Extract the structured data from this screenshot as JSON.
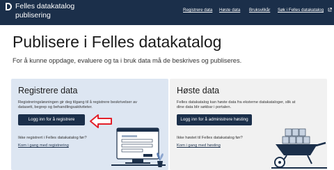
{
  "header": {
    "brand_line1": "Felles datakatalog",
    "brand_line2": "publisering",
    "nav": [
      "Registrere data",
      "Høste data",
      "Bruksvilkår",
      "Søk i Felles datakatalog"
    ]
  },
  "main": {
    "title": "Publisere i Felles datakatalog",
    "lead": "For å kunne oppdage, evaluere og ta i bruk data må de beskrives og publiseres."
  },
  "cards": {
    "register": {
      "title": "Registrere data",
      "desc_line1": "Registreringsløsningen gir deg tilgang til å registrere beskrivelser av",
      "desc_line2": "datasett, begrep og behandlingsaktiviteter.",
      "button": "Logg inn for å registrere",
      "sub_text": "Ikke registrert i Felles datakatalog før?",
      "link": "Kom i gang med registrering"
    },
    "harvest": {
      "title": "Høste data",
      "desc_line1": "Felles datakatalog kan høste data fra eksterne datakataloger, slik at",
      "desc_line2": "dine data blir søkbar i portalen.",
      "button": "Logg inn for å administrere høsting",
      "sub_text": "Ikke høstet til Felles datakatalog før?",
      "link": "Kom i gang med høsting"
    }
  },
  "colors": {
    "header_bg": "#1b2f4a",
    "register_card_bg": "#dde6f2",
    "harvest_card_bg": "#f1f1f1",
    "arrow": "#e3202a"
  },
  "icons": [
    "logo-icon",
    "external-link-icon",
    "red-arrow-icon",
    "computer-form-illustration",
    "plant-icon",
    "wheelbarrow-illustration"
  ]
}
